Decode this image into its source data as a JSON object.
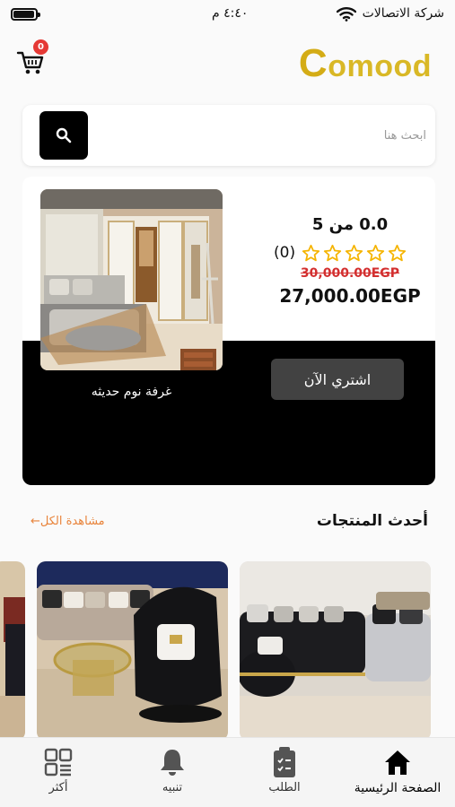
{
  "status_bar": {
    "carrier": "شركة الاتصالات",
    "time": "٤:٤٠ م",
    "battery_level": 0.9
  },
  "header": {
    "cart_count": "0",
    "logo_first": "C",
    "logo_rest": "omood"
  },
  "search": {
    "placeholder": "ابحث هنا"
  },
  "featured": {
    "rating_score": "0.0 من 5",
    "rating_stars": 0,
    "rating_count": "(0)",
    "old_price": "30,000.00EGP",
    "new_price": "27,000.00EGP",
    "buy_label": "اشتري الآن",
    "product_name": "غرفة نوم حديثه"
  },
  "latest": {
    "title": "أحدث المنتجات",
    "see_all": "مشاهدة الكل←"
  },
  "products": [
    {
      "image": "grey-velvet-sofa-set"
    },
    {
      "image": "black-velvet-armchair"
    },
    {
      "image": "partial-product"
    }
  ],
  "nav": [
    {
      "label": "الصفحة الرئيسية",
      "icon": "home-icon",
      "active": true
    },
    {
      "label": "الطلب",
      "icon": "clipboard-icon",
      "active": false
    },
    {
      "label": "تنبيه",
      "icon": "bell-icon",
      "active": false
    },
    {
      "label": "أكثر",
      "icon": "grid-menu-icon",
      "active": false
    }
  ],
  "colors": {
    "accent": "#E8833A",
    "logo": "#D9B826",
    "badge": "#E53935",
    "old_price": "#D32F2F"
  }
}
